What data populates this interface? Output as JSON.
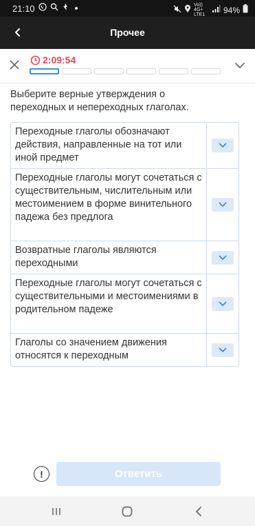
{
  "status_bar": {
    "time": "21:10",
    "network_label": "Vo)) 4G+ LTE1",
    "battery": "94%",
    "icons": [
      "viber-icon",
      "search-icon",
      "notification-icon",
      "dot-icon",
      "mute-icon",
      "location-icon",
      "signal-icon",
      "battery-icon"
    ]
  },
  "app_bar": {
    "title": "Прочее",
    "back_icon": "arrow-back-icon"
  },
  "quiz_header": {
    "timer": "2:09:54",
    "timer_color": "#e8454f",
    "progress": {
      "total_segments": 6,
      "current_segment": 1
    },
    "accent_color": "#3d8ce6"
  },
  "question": "Выберите верные утверждения о переходных и непереходных глаголах.",
  "options": [
    {
      "text": "Переходные глаголы обозначают действия, направленные на тот или иной предмет"
    },
    {
      "text": "Переходные глаголы могут сочетаться с существительным, числительным или местоимением в форме винительного падежа без предлога"
    },
    {
      "text": "Возвратные глаголы являются переходными"
    },
    {
      "text": "Переходные глаголы могут сочетаться с существительными и местоимениями в родительном падеже"
    },
    {
      "text": "Глаголы со значением движения относятся к переходным"
    }
  ],
  "footer": {
    "help_symbol": "!",
    "submit_label": "Ответить",
    "submit_enabled": false
  }
}
